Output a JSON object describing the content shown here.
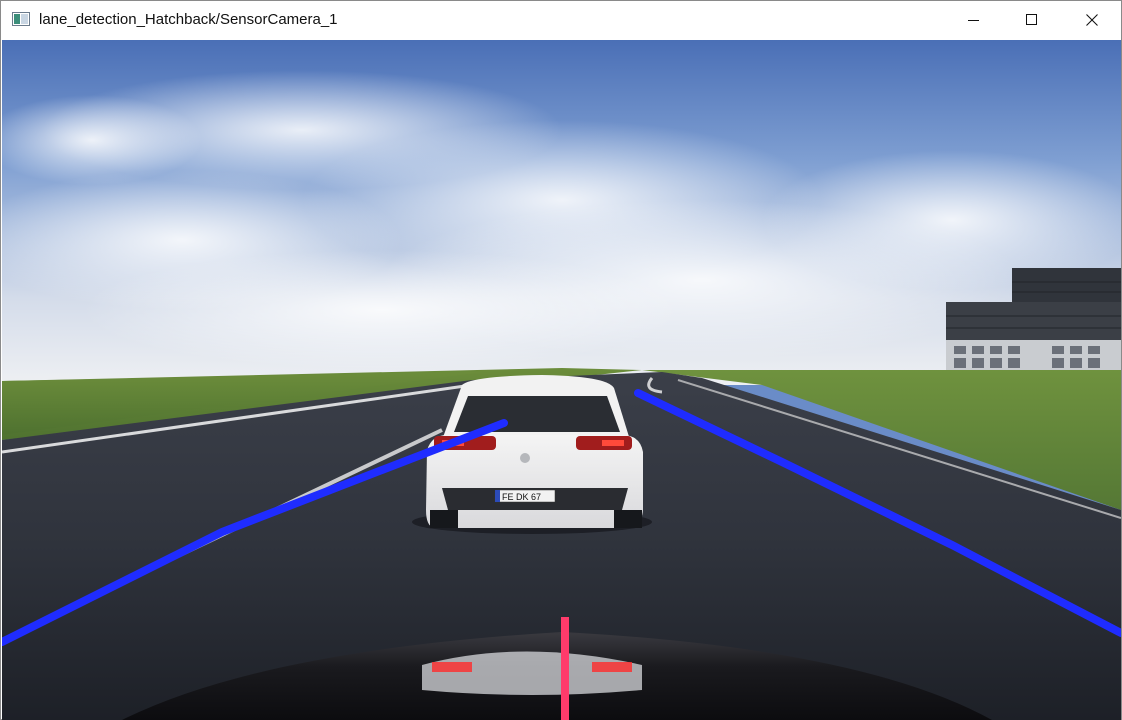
{
  "window": {
    "title": "lane_detection_Hatchback/SensorCamera_1",
    "app_icon": "image-window-icon",
    "controls": {
      "minimize_icon": "minimize-icon",
      "maximize_icon": "maximize-icon",
      "close_icon": "close-icon"
    }
  },
  "camera_view": {
    "sensor": "SensorCamera_1",
    "vehicle_plate": "FE DK 67",
    "overlay_colors": {
      "lane_lines": "#1f2cff",
      "center_marker": "#ff3b6b"
    }
  }
}
